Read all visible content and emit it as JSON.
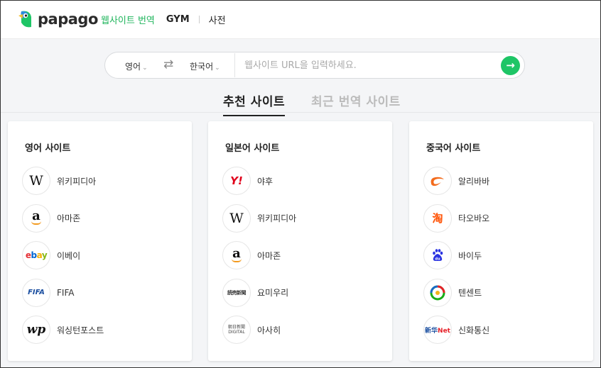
{
  "header": {
    "logo_text": "papago",
    "nav": [
      {
        "label": "웹사이트 번역"
      },
      {
        "label": "GYM"
      },
      {
        "label": "사전"
      }
    ]
  },
  "urlbar": {
    "source_lang": "영어",
    "target_lang": "한국어",
    "swap_icon": "⇄",
    "url_value": "",
    "url_placeholder": "웹사이트 URL을 입력하세요.",
    "go_icon": "→"
  },
  "tabs": [
    {
      "label": "추천 사이트"
    },
    {
      "label": "최근 번역 사이트"
    }
  ],
  "cards": [
    {
      "title": "영어 사이트",
      "sites": [
        {
          "name": "위키피디아",
          "icon": "wikipedia-icon",
          "glyph": "W"
        },
        {
          "name": "아마존",
          "icon": "amazon-icon",
          "glyph": "a"
        },
        {
          "name": "이베이",
          "icon": "ebay-icon",
          "glyph": "ebay"
        },
        {
          "name": "FIFA",
          "icon": "fifa-icon",
          "glyph": "FIFA"
        },
        {
          "name": "워싱턴포스트",
          "icon": "washington-post-icon",
          "glyph": "wp"
        }
      ]
    },
    {
      "title": "일본어 사이트",
      "sites": [
        {
          "name": "야후",
          "icon": "yahoo-icon",
          "glyph": "Y!"
        },
        {
          "name": "위키피디아",
          "icon": "wikipedia-icon",
          "glyph": "W"
        },
        {
          "name": "아마존",
          "icon": "amazon-icon",
          "glyph": "a"
        },
        {
          "name": "요미우리",
          "icon": "yomiuri-icon",
          "glyph": "読売新聞"
        },
        {
          "name": "아사히",
          "icon": "asahi-icon",
          "glyph": "朝日新聞 DIGITAL"
        }
      ]
    },
    {
      "title": "중국어 사이트",
      "sites": [
        {
          "name": "알리바바",
          "icon": "alibaba-icon",
          "glyph": "ℯ"
        },
        {
          "name": "타오바오",
          "icon": "taobao-icon",
          "glyph": "淘"
        },
        {
          "name": "바이두",
          "icon": "baidu-icon",
          "glyph": "du"
        },
        {
          "name": "텐센트",
          "icon": "tencent-icon",
          "glyph": ""
        },
        {
          "name": "신화통신",
          "icon": "xinhua-icon",
          "glyph": "新华 Net"
        }
      ]
    }
  ],
  "colors": {
    "accent": "#1ec566",
    "active_nav": "#1fb55c"
  }
}
